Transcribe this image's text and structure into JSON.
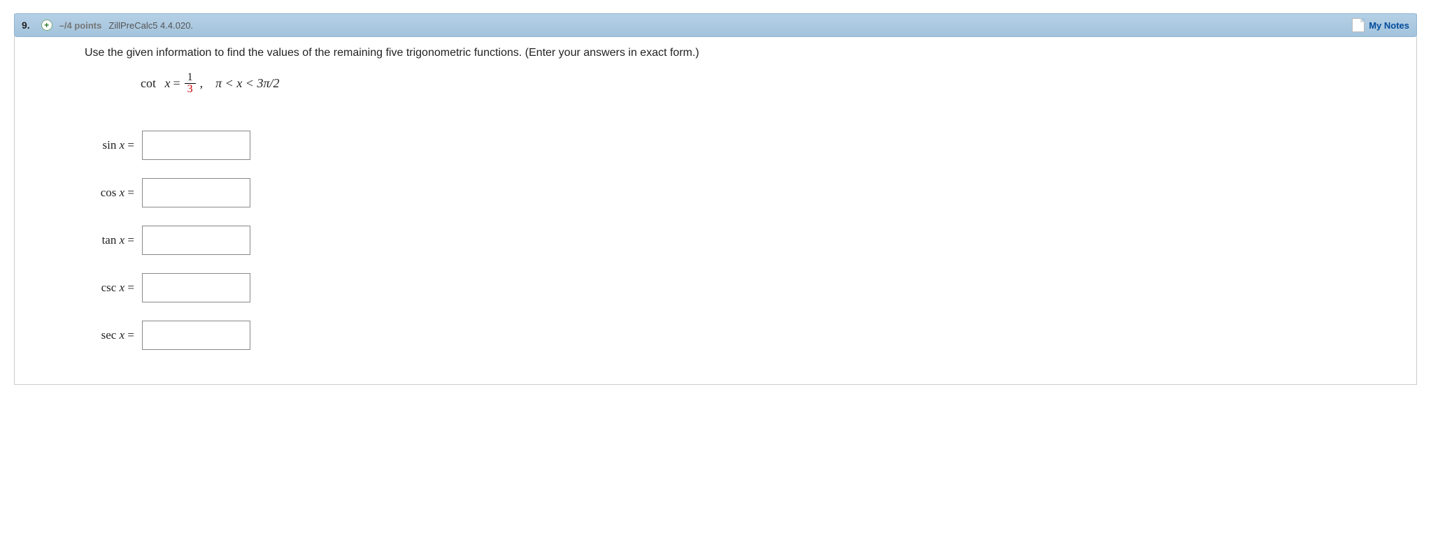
{
  "header": {
    "number": "9.",
    "expand_symbol": "+",
    "points": "–/4 points",
    "source": "ZillPreCalc5 4.4.020.",
    "my_notes": "My Notes"
  },
  "prompt": "Use the given information to find the values of the remaining five trigonometric functions. (Enter your answers in exact form.)",
  "given": {
    "func": "cot",
    "var": "x",
    "eq": " = ",
    "numerator": "1",
    "denominator": "3",
    "comma": ",",
    "interval": "π < x < 3π/2"
  },
  "answers": [
    {
      "label_func": "sin",
      "label_var": "x",
      "label_eq": " = ",
      "value": ""
    },
    {
      "label_func": "cos",
      "label_var": "x",
      "label_eq": " = ",
      "value": ""
    },
    {
      "label_func": "tan",
      "label_var": "x",
      "label_eq": " = ",
      "value": ""
    },
    {
      "label_func": "csc",
      "label_var": "x",
      "label_eq": " = ",
      "value": ""
    },
    {
      "label_func": "sec",
      "label_var": "x",
      "label_eq": " = ",
      "value": ""
    }
  ]
}
